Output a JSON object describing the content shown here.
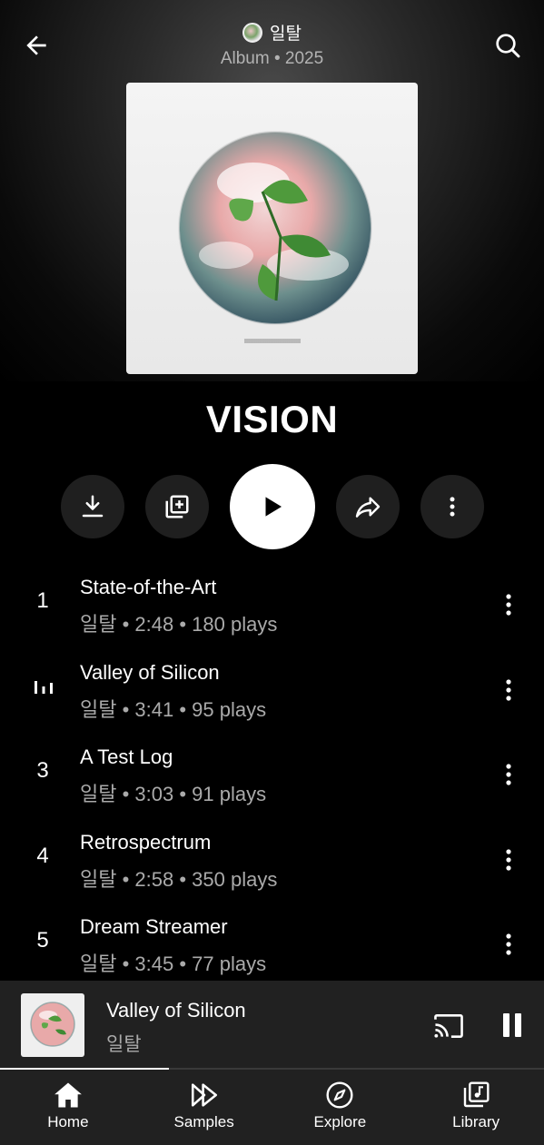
{
  "header": {
    "artist": "일탈",
    "subtitle": "Album • 2025"
  },
  "album": {
    "title": "VISION"
  },
  "tracks": [
    {
      "number": "1",
      "title": "State-of-the-Art",
      "meta": "일탈 • 2:48 • 180 plays",
      "playing": false
    },
    {
      "number": "",
      "title": "Valley of Silicon",
      "meta": "일탈 • 3:41 • 95 plays",
      "playing": true
    },
    {
      "number": "3",
      "title": "A Test Log",
      "meta": "일탈 • 3:03 • 91 plays",
      "playing": false
    },
    {
      "number": "4",
      "title": "Retrospectrum",
      "meta": "일탈 • 2:58 • 350 plays",
      "playing": false
    },
    {
      "number": "5",
      "title": "Dream Streamer",
      "meta": "일탈 • 3:45 • 77 plays",
      "playing": false
    }
  ],
  "mini_player": {
    "title": "Valley of Silicon",
    "artist": "일탈",
    "progress": 0.31
  },
  "nav": {
    "home": "Home",
    "samples": "Samples",
    "explore": "Explore",
    "library": "Library"
  },
  "colors": {
    "background": "#000000",
    "surface": "#212121",
    "button_bg": "#1f1f1f",
    "secondary_text": "#aaaaaa"
  }
}
